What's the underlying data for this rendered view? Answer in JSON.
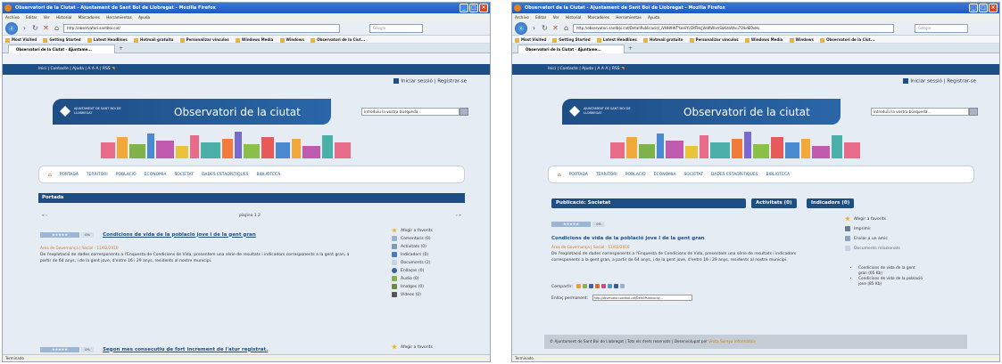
{
  "left": {
    "window_title": "Observatori de la Ciutat - Ajuntament de Sant Boi de Llobregat - Mozilla Firefox",
    "menu": [
      "Archivo",
      "Editar",
      "Ver",
      "Historial",
      "Marcadores",
      "Herramientas",
      "Ayuda"
    ],
    "url": "http://observatori.santboi.cat/",
    "search_placeholder": "Google",
    "bookmarks": [
      "Most Visited",
      "Getting Started",
      "Latest Headlines",
      "Hotmail gratuito",
      "Personalizar vínculos",
      "Windows Media",
      "Windows",
      "Observatori de la Ciut..."
    ],
    "tab_title": "Observatori de la Ciutat - Ajuntame...",
    "site_strip": {
      "links": "Inici | Contacte | Ajuda | A A A | RSS",
      "rss_icon": "rss-icon"
    },
    "login": "Iniciar sessió | Registrar-se",
    "ajuntament": "AJUNTAMENT DE SANT BOI DE LLOBREGAT",
    "site_title": "Observatori de la ciutat",
    "search_text": "Introduïu la vostra búsqueda...",
    "nav": [
      "PORTADA",
      "TERRITORI",
      "POBLACIÓ",
      "ECONOMIA",
      "SOCIETAT",
      "DADES ESTADÍSTIQUES",
      "BIBLIOTECA"
    ],
    "section": "Portada",
    "pager": {
      "left": "« ‹",
      "center": "pàgina 1 2",
      "right": "› »"
    },
    "article1": {
      "rating": "★★★★★",
      "pct": "0%",
      "title": "Condicions de vida de la població jove i de la gent gran",
      "meta": "Àrea de Governança | Social - 11/02/2010",
      "excerpt": "De l'explotació de dades corresponents a l'Enquesta de Condicions de Vida, presentem una sèrie de resultats i indicadors corresponents a la gent gran, a partir de 64 anys, i de la gent jove, d'entre 16 i 29 anys, residents al nostre municipi."
    },
    "sidebar1": [
      "Afegir a favorits",
      "Comentaris (0)",
      "Activitats (0)",
      "Indicadors (0)",
      "Documents (2)",
      "Enllaços (0)",
      "Àudio (0)",
      "Imatges (0)",
      "Vídeos (0)"
    ],
    "article2": {
      "rating": "★★★★★",
      "pct": "0%",
      "title": "Segon mes consecutiu de fort increment de l'atur registrat."
    },
    "sidebar2": [
      "Afegir a favorits"
    ],
    "status": "Terminado"
  },
  "right": {
    "window_title": "Observatori de la Ciutat - Ajuntament de Sant Boi de Llobregat - Mozilla Firefox",
    "menu": [
      "Archivo",
      "Editar",
      "Ver",
      "Historial",
      "Marcadores",
      "Herramientas",
      "Ayuda"
    ],
    "url": "http://observatori.santboi.cat/DetallPublicacio/_iVHH9WTYzeliYzl2tFHcjVeWWIvnSaKdaWvu72lkdE0xHs",
    "search_placeholder": "Google",
    "bookmarks": [
      "Most Visited",
      "Getting Started",
      "Latest Headlines",
      "Hotmail gratuito",
      "Personalizar vínculos",
      "Windows Media",
      "Windows",
      "Observatori de la Ciut..."
    ],
    "tab_title": "Observatori de la Ciutat - Ajuntame...",
    "site_strip": {
      "links": "Inici | Contacte | Ajuda | A A A | RSS",
      "rss_icon": "rss-icon"
    },
    "login": "Iniciar sessió | Registrar-se",
    "ajuntament": "AJUNTAMENT DE SANT BOI DE LLOBREGAT",
    "site_title": "Observatori de la ciutat",
    "search_text": "Introduïu la vostra búsqueda...",
    "nav": [
      "PORTADA",
      "TERRITORI",
      "POBLACIÓ",
      "ECONOMIA",
      "SOCIETAT",
      "DADES ESTADÍSTIQUES",
      "BIBLIOTECA"
    ],
    "pub_tabs": [
      "Publicació: Societat",
      "Activitats (0)",
      "Indicadors (0)"
    ],
    "article": {
      "rating": "★★★★★",
      "pct": "0%",
      "title": "Condicions de vida de la població jove i de la gent gran",
      "meta": "Àrea de Governança | Social - 11/02/2010",
      "excerpt": "De l'explotació de dades corresponents a l'Enquesta de Condicions de Vida, presentem una sèrie de resultats i indicadors corresponents a la gent gran, a partir de 64 anys, i de la gent jove, d'entre 16 i 29 anys, residents al nostre municipi."
    },
    "share_label": "Compartir:",
    "permalink_label": "Enllaç permanent:",
    "permalink_value": "http://observatori.santboi.cat/DetallPublicacio/...",
    "actions": [
      "Afegir a favorits",
      "Imprimir",
      "Enviar a un amic",
      "Documents relacionats"
    ],
    "docs": [
      "Condicions de vida de la gent gran (65 Kb)",
      "Condicions de vida de la població jove (85 Kb)"
    ],
    "footer": "© Ajuntament de Sant Boi de Llobregat | Tots els drets reservats | Desenvolupat per",
    "footer_dev": "Visita Soreya Informàtica",
    "status": "Terminado"
  },
  "colors": {
    "site_blue": "#1e4e86",
    "orange": "#d17a14",
    "firefox_blue": "#1f5bbf"
  }
}
